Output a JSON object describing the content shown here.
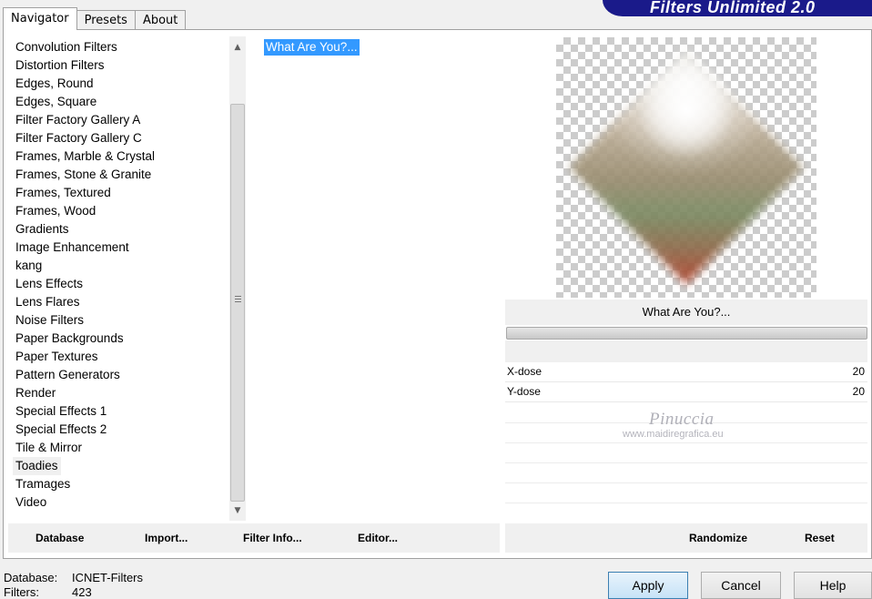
{
  "tabs": [
    {
      "label": "Navigator",
      "active": true
    },
    {
      "label": "Presets",
      "active": false
    },
    {
      "label": "About",
      "active": false
    }
  ],
  "banner_title": "Filters Unlimited 2.0",
  "categories": [
    "Convolution Filters",
    "Distortion Filters",
    "Edges, Round",
    "Edges, Square",
    "Filter Factory Gallery A",
    "Filter Factory Gallery C",
    "Frames, Marble & Crystal",
    "Frames, Stone & Granite",
    "Frames, Textured",
    "Frames, Wood",
    "Gradients",
    "Image Enhancement",
    "kang",
    "Lens Effects",
    "Lens Flares",
    "Noise Filters",
    "Paper Backgrounds",
    "Paper Textures",
    "Pattern Generators",
    "Render",
    "Special Effects 1",
    "Special Effects 2",
    "Tile & Mirror",
    "Toadies",
    "Tramages",
    "Video"
  ],
  "selected_category": "Toadies",
  "filters": [
    "What Are You?..."
  ],
  "selected_filter_title": "What Are You?...",
  "params": [
    {
      "label": "X-dose",
      "value": "20"
    },
    {
      "label": "Y-dose",
      "value": "20"
    }
  ],
  "watermark": {
    "name": "Pinuccia",
    "url": "www.maidiregrafica.eu"
  },
  "list_buttons": {
    "database": "Database",
    "import": "Import...",
    "filter_info": "Filter Info...",
    "editor": "Editor..."
  },
  "param_buttons": {
    "randomize": "Randomize",
    "reset": "Reset"
  },
  "status": {
    "database_label": "Database:",
    "database_value": "ICNET-Filters",
    "filters_label": "Filters:",
    "filters_value": "423"
  },
  "dialog_buttons": {
    "apply": "Apply",
    "cancel": "Cancel",
    "help": "Help"
  },
  "colors": {
    "banner": "#1a1a8a",
    "selection": "#3399ff"
  }
}
